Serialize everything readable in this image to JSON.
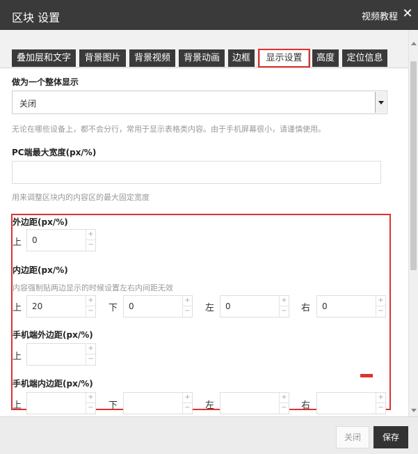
{
  "header": {
    "title": "区块 设置",
    "tutorial_link": "视频教程",
    "close_glyph": "✕"
  },
  "tabs": [
    {
      "label": "叠加层和文字",
      "active": false
    },
    {
      "label": "背景图片",
      "active": false
    },
    {
      "label": "背景视频",
      "active": false
    },
    {
      "label": "背景动画",
      "active": false
    },
    {
      "label": "边框",
      "active": false
    },
    {
      "label": "显示设置",
      "active": true
    },
    {
      "label": "高度",
      "active": false
    },
    {
      "label": "定位信息",
      "active": false
    }
  ],
  "display_as_whole": {
    "label": "做为一个整体显示",
    "value": "关闭",
    "help": "无论在哪些设备上，都不会分行，常用于显示表格类内容。由于手机屏幕很小，请谨慎使用。"
  },
  "pc_max_width": {
    "label": "PC端最大宽度(px/%)",
    "value": "",
    "help": "用来调整区块内的内容区的最大固定宽度"
  },
  "margin": {
    "label": "外边距(px/%)",
    "fields": [
      {
        "side": "上",
        "value": "0"
      }
    ]
  },
  "padding": {
    "label": "内边距(px/%)",
    "help": "内容强制贴两边显示的时候设置左右内间距无效",
    "fields": [
      {
        "side": "上",
        "value": "20"
      },
      {
        "side": "下",
        "value": "0"
      },
      {
        "side": "左",
        "value": "0"
      },
      {
        "side": "右",
        "value": "0"
      }
    ]
  },
  "mobile_margin": {
    "label": "手机端外边距(px/%)",
    "fields": [
      {
        "side": "上",
        "value": ""
      }
    ]
  },
  "mobile_padding": {
    "label": "手机端内边距(px/%)",
    "fields": [
      {
        "side": "上",
        "value": ""
      },
      {
        "side": "下",
        "value": ""
      },
      {
        "side": "左",
        "value": ""
      },
      {
        "side": "右",
        "value": ""
      }
    ]
  },
  "spinner": {
    "plus": "+",
    "minus": "−"
  },
  "footer": {
    "close_label": "关闭",
    "save_label": "保存"
  },
  "colors": {
    "titlebar": "#3a3a3a",
    "highlight": "#e03030",
    "save_button": "#333333"
  }
}
